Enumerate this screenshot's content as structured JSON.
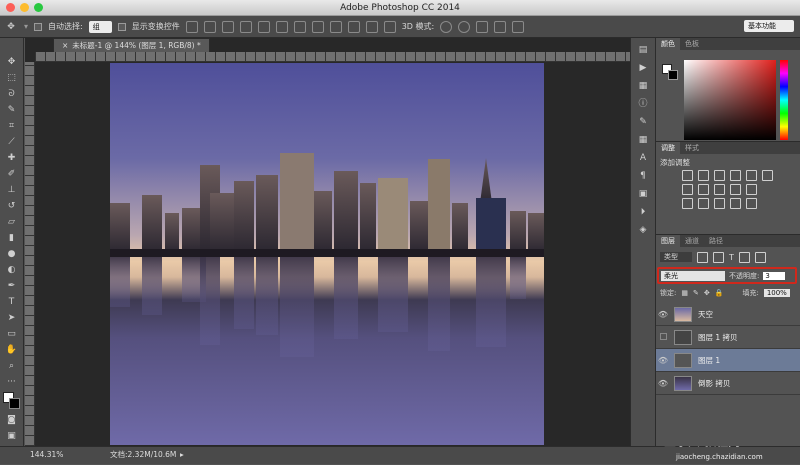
{
  "window": {
    "title": "Adobe Photoshop CC 2014"
  },
  "options_bar": {
    "auto_select_label": "自动选择:",
    "auto_select_value": "组",
    "show_transform_label": "显示变换控件",
    "mode_3d_label": "3D 模式:",
    "workspace": "基本功能"
  },
  "document": {
    "tab_title": "未标题-1 @ 144% (图层 1, RGB/8) *"
  },
  "status": {
    "zoom": "144.31%",
    "doc_size": "文档:2.32M/10.6M"
  },
  "color_panel": {
    "tabs": [
      "颜色",
      "色板"
    ],
    "accent": "#e0201c"
  },
  "adjust_panel": {
    "tabs": [
      "调整",
      "样式"
    ],
    "add_label": "添加调整"
  },
  "layers_panel": {
    "tabs": [
      "图层",
      "通道",
      "路径"
    ],
    "filter_kind": "类型",
    "blend_mode": "柔光",
    "opacity_label": "不透明度:",
    "opacity_value": "3",
    "lock_label": "锁定:",
    "fill_label": "填充:",
    "fill_value": "100%",
    "layers": [
      {
        "name": "天空",
        "visible": true,
        "selected": false
      },
      {
        "name": "图层 1 拷贝",
        "visible": false,
        "selected": false
      },
      {
        "name": "图层 1",
        "visible": true,
        "selected": true
      },
      {
        "name": "倒影 拷贝",
        "visible": true,
        "selected": false
      }
    ]
  },
  "watermark": {
    "line1": "查字典 教程网",
    "line2": "jiaocheng.chazidian.com"
  },
  "highlight_color": "#d0281c"
}
